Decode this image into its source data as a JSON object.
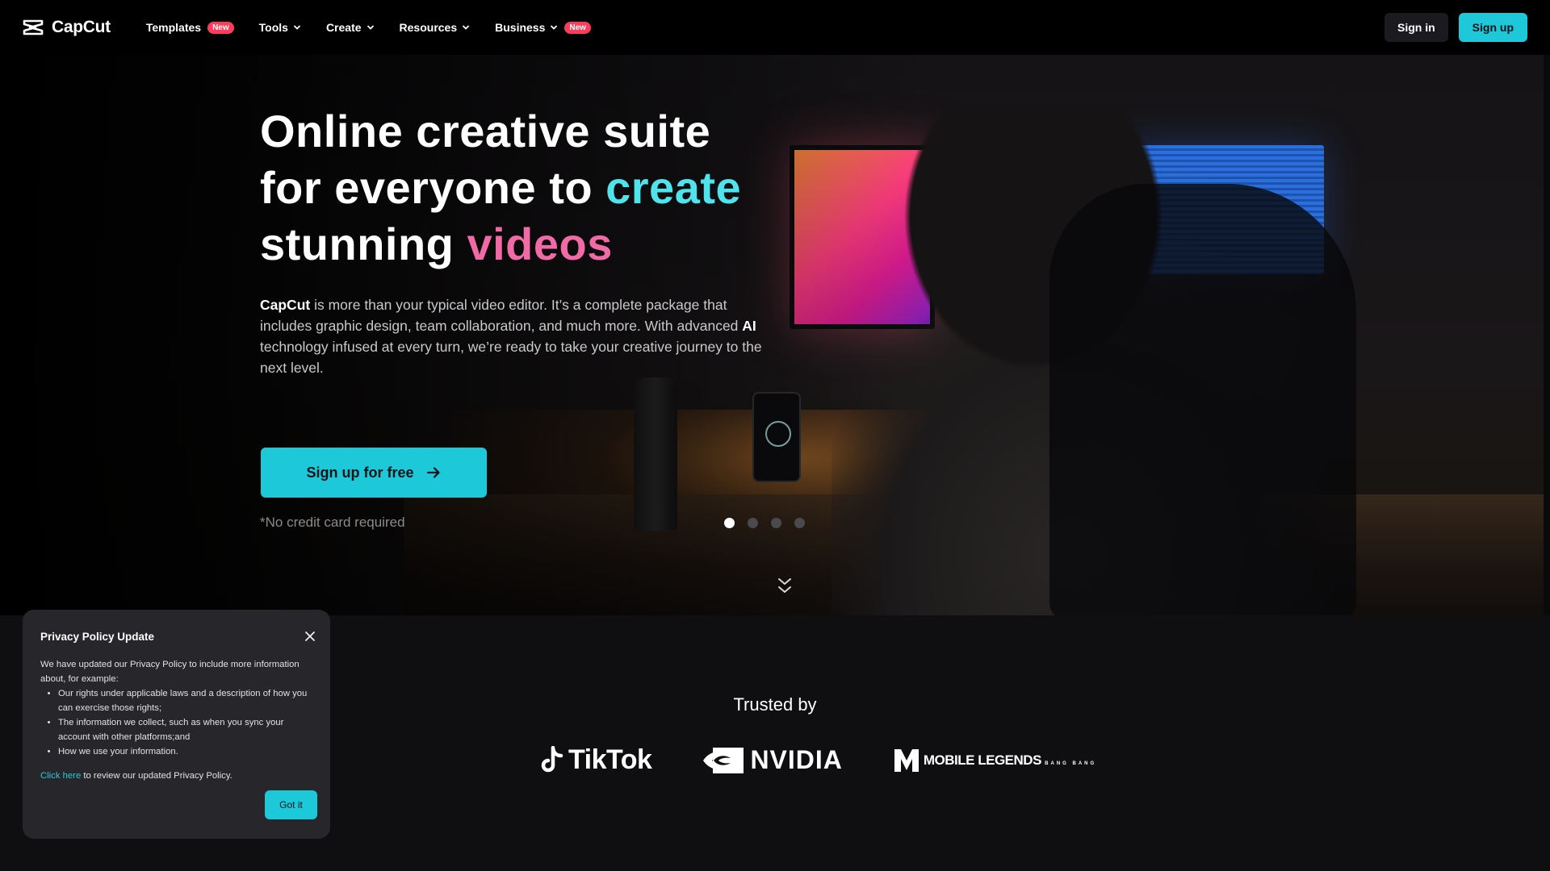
{
  "nav": {
    "logo_text": "CapCut",
    "items": [
      {
        "label": "Templates",
        "badge": "New",
        "has_chevron": false
      },
      {
        "label": "Tools",
        "badge": "",
        "has_chevron": true
      },
      {
        "label": "Create",
        "badge": "",
        "has_chevron": true
      },
      {
        "label": "Resources",
        "badge": "",
        "has_chevron": true
      },
      {
        "label": "Business",
        "badge": "New",
        "has_chevron": true
      }
    ],
    "sign_in": "Sign in",
    "sign_up": "Sign up"
  },
  "hero": {
    "title_line1": "Online creative suite",
    "title_line2_a": "for everyone to ",
    "title_line2_b": "create",
    "title_line3_a": "stunning ",
    "title_line3_b": "videos",
    "desc_brand": "CapCut",
    "desc_1": " is more than your typical video editor. It’s a complete package that includes graphic design, team collaboration, and much more. With advanced ",
    "desc_ai": "AI",
    "desc_2": " technology infused at every turn, we’re ready to take your creative journey to the next level.",
    "cta": "Sign up for free",
    "note": "*No credit card required",
    "carousel_active": 1,
    "carousel_count": 4
  },
  "trusted": {
    "title": "Trusted by",
    "brands": {
      "tiktok": "TikTok",
      "nvidia": "NVIDIA",
      "ml_line1": "MOBILE",
      "ml_line2": "LEGENDS",
      "ml_line3": "BANG BANG"
    }
  },
  "privacy": {
    "title": "Privacy Policy Update",
    "intro": "We have updated our Privacy Policy to include more information about, for example:",
    "bullets": [
      "Our rights under applicable laws and a description of how you can exercise those rights;",
      "The information we collect, such as when you sync your account with other platforms;and",
      "How we use your information."
    ],
    "link_text": "Click here",
    "link_suffix": " to review our updated Privacy Policy.",
    "button": "Got it"
  },
  "colors": {
    "accent_cyan": "#1dc8d8",
    "title_cyan": "#4fe3ec",
    "title_pink": "#f06aa5",
    "badge_red": "#ff3d5a"
  }
}
